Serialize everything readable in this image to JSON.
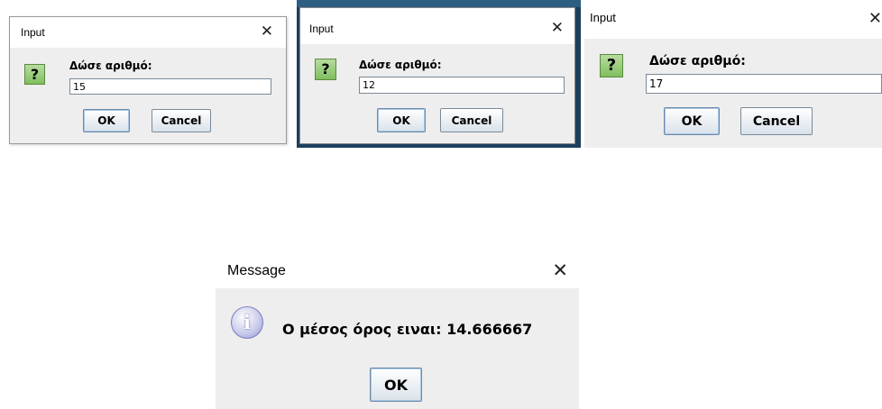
{
  "dialogs": [
    {
      "title": "Input",
      "close_icon": "close-icon",
      "icon": "question-icon",
      "icon_glyph": "?",
      "prompt": "Δώσε αριθμό:",
      "value": "15",
      "ok_label": "OK",
      "cancel_label": "Cancel"
    },
    {
      "title": "Input",
      "close_icon": "close-icon",
      "icon": "question-icon",
      "icon_glyph": "?",
      "prompt": "Δώσε αριθμό:",
      "value": "12",
      "ok_label": "OK",
      "cancel_label": "Cancel"
    },
    {
      "title": "Input",
      "close_icon": "close-icon",
      "icon": "question-icon",
      "icon_glyph": "?",
      "prompt": "Δώσε αριθμό:",
      "value": "17",
      "ok_label": "OK",
      "cancel_label": "Cancel"
    }
  ],
  "message": {
    "title": "Message",
    "close_icon": "close-icon",
    "icon": "information-icon",
    "icon_glyph": "i",
    "text": "Ο μέσος όρος ειναι:  14.666667",
    "ok_label": "OK"
  },
  "colors": {
    "dialog_body": "#eeeeee",
    "question_icon": "#7fbf5e",
    "info_icon": "#c6c8ea",
    "background_window": "#1c3f5e"
  },
  "close_glyph": "✕"
}
